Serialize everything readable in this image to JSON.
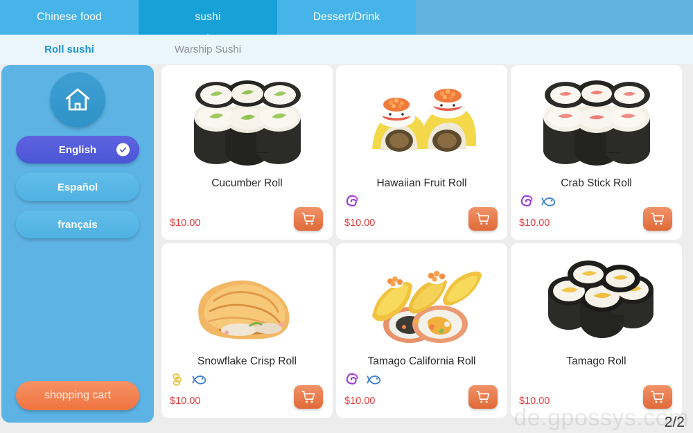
{
  "header": {
    "tabs": [
      {
        "label": "Chinese food",
        "active": false
      },
      {
        "label": "sushi",
        "active": true
      },
      {
        "label": "Dessert/Drink",
        "active": false
      }
    ],
    "subtabs": [
      {
        "label": "Roll sushi",
        "active": true
      },
      {
        "label": "Warship Sushi",
        "active": false
      }
    ]
  },
  "sidebar": {
    "home_icon": "home-icon",
    "languages": [
      {
        "label": "English",
        "selected": true
      },
      {
        "label": "Español",
        "selected": false
      },
      {
        "label": "français",
        "selected": false
      }
    ],
    "cart_label": "shopping cart"
  },
  "products": [
    {
      "name": "Cucumber Roll",
      "price": "$10.00",
      "image": "cucumber-roll-image",
      "tags": [],
      "add_icon": "shopping-cart-icon"
    },
    {
      "name": "Hawaiian Fruit Roll",
      "price": "$10.00",
      "image": "hawaiian-fruit-roll-image",
      "tags": [
        "squid-tag-icon"
      ],
      "add_icon": "shopping-cart-icon"
    },
    {
      "name": "Crab Stick Roll",
      "price": "$10.00",
      "image": "crab-stick-roll-image",
      "tags": [
        "squid-tag-icon",
        "fish-tag-icon"
      ],
      "add_icon": "shopping-cart-icon"
    },
    {
      "name": "Snowflake Crisp Roll",
      "price": "$10.00",
      "image": "snowflake-crisp-roll-image",
      "tags": [
        "scallop-tag-icon",
        "fish-tag-icon"
      ],
      "add_icon": "shopping-cart-icon"
    },
    {
      "name": "Tamago California Roll",
      "price": "$10.00",
      "image": "tamago-california-roll-image",
      "tags": [
        "squid-tag-icon",
        "fish-tag-icon"
      ],
      "add_icon": "shopping-cart-icon"
    },
    {
      "name": "Tamago Roll",
      "price": "$10.00",
      "image": "tamago-roll-image",
      "tags": [],
      "add_icon": "shopping-cart-icon"
    }
  ],
  "footer": {
    "watermark": "de.gpossys.com",
    "page_indicator": "2/2"
  },
  "colors": {
    "header_active": "#18a0d8",
    "header_tab": "#46b4e8",
    "subbar_bg": "#eaf6fc",
    "subtab_active": "#2196d3",
    "sidebar_bg": "#5cb3e4",
    "lang_selected": "#5057d8",
    "cart_orange": "#f0733f",
    "price_red": "#e23b3b",
    "page_bg": "#ededed"
  }
}
